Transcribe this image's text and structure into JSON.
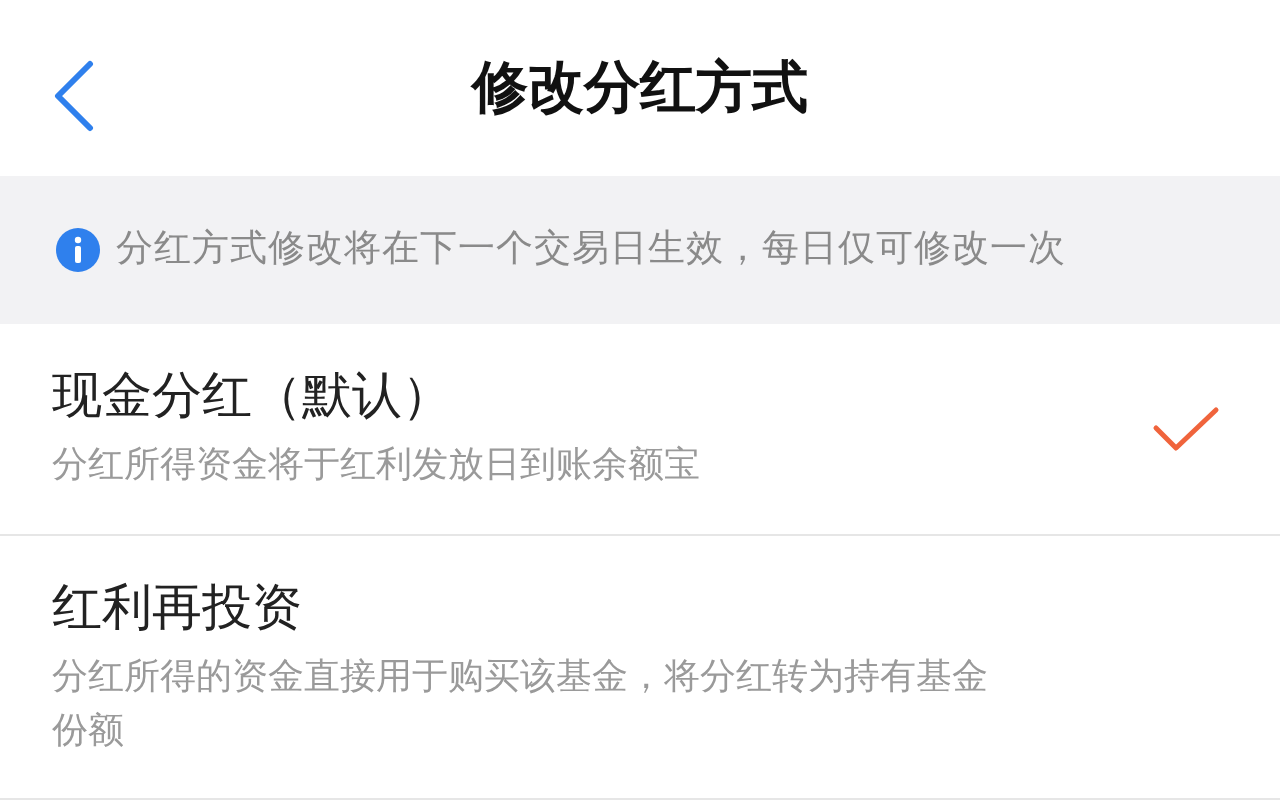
{
  "header": {
    "title": "修改分红方式"
  },
  "notice": {
    "text": "分红方式修改将在下一个交易日生效，每日仅可修改一次"
  },
  "options": [
    {
      "title": "现金分红（默认）",
      "description": "分红所得资金将于红利发放日到账余额宝",
      "selected": true
    },
    {
      "title": "红利再投资",
      "description": "分红所得的资金直接用于购买该基金，将分红转为持有基金份额",
      "selected": false
    }
  ]
}
